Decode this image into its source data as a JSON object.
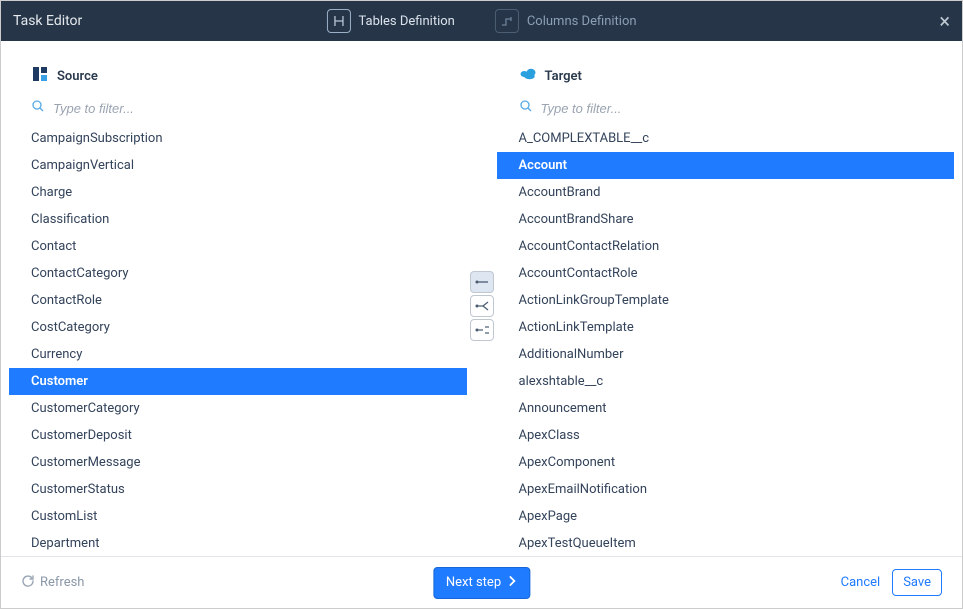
{
  "header": {
    "title": "Task Editor",
    "tabs": [
      {
        "label": "Tables Definition",
        "active": true
      },
      {
        "label": "Columns Definition",
        "active": false
      }
    ]
  },
  "source": {
    "title": "Source",
    "filter_placeholder": "Type to filter...",
    "selected": "Customer",
    "items": [
      "CampaignSubscription",
      "CampaignVertical",
      "Charge",
      "Classification",
      "Contact",
      "ContactCategory",
      "ContactRole",
      "CostCategory",
      "Currency",
      "Customer",
      "CustomerCategory",
      "CustomerDeposit",
      "CustomerMessage",
      "CustomerStatus",
      "CustomList",
      "Department"
    ]
  },
  "target": {
    "title": "Target",
    "filter_placeholder": "Type to filter...",
    "selected": "Account",
    "items": [
      "A_COMPLEXTABLE__c",
      "Account",
      "AccountBrand",
      "AccountBrandShare",
      "AccountContactRelation",
      "AccountContactRole",
      "ActionLinkGroupTemplate",
      "ActionLinkTemplate",
      "AdditionalNumber",
      "alexshtable__c",
      "Announcement",
      "ApexClass",
      "ApexComponent",
      "ApexEmailNotification",
      "ApexPage",
      "ApexTestQueueItem"
    ]
  },
  "footer": {
    "refresh": "Refresh",
    "next": "Next step",
    "cancel": "Cancel",
    "save": "Save"
  }
}
